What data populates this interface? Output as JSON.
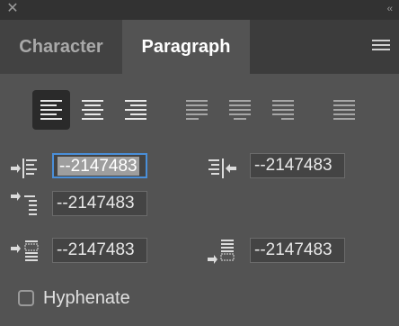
{
  "panel": {
    "close_glyph": "✕",
    "collapse_glyph": "‹‹",
    "menu_icon": "hamburger-icon"
  },
  "tabs": [
    {
      "label": "Character",
      "active": false
    },
    {
      "label": "Paragraph",
      "active": true
    }
  ],
  "alignment_buttons": [
    {
      "name": "align-left",
      "selected": true
    },
    {
      "name": "align-center",
      "selected": false
    },
    {
      "name": "align-right",
      "selected": false
    },
    {
      "name": "justify-last-left",
      "selected": false
    },
    {
      "name": "justify-last-center",
      "selected": false
    },
    {
      "name": "justify-last-right",
      "selected": false
    },
    {
      "name": "justify-all",
      "selected": false
    }
  ],
  "fields": {
    "left_indent": {
      "value": "--2147483"
    },
    "right_indent": {
      "value": "--2147483"
    },
    "first_line_indent": {
      "value": "--2147483"
    },
    "space_before": {
      "value": "--2147483"
    },
    "space_after": {
      "value": "--2147483"
    }
  },
  "hyphenate": {
    "label": "Hyphenate",
    "checked": false
  },
  "colors": {
    "panel_bg": "#535353",
    "tabbar_bg": "#3c3c3c",
    "focus_ring": "#4a8fd9",
    "text": "#d6d6d6"
  }
}
